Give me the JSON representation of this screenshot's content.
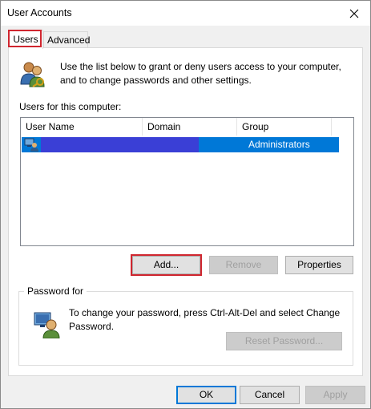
{
  "window": {
    "title": "User Accounts"
  },
  "tabs": [
    {
      "label": "Users"
    },
    {
      "label": "Advanced"
    }
  ],
  "info": {
    "text": "Use the list below to grant or deny users access to your computer, and to change passwords and other settings."
  },
  "users_section": {
    "label": "Users for this computer:",
    "columns": [
      "User Name",
      "Domain",
      "Group"
    ],
    "rows": [
      {
        "group": "Administrators"
      }
    ]
  },
  "buttons": {
    "add": "Add...",
    "remove": "Remove",
    "properties": "Properties",
    "reset_password": "Reset Password...",
    "ok": "OK",
    "cancel": "Cancel",
    "apply": "Apply"
  },
  "password": {
    "legend": "Password for",
    "text": "To change your password, press Ctrl-Alt-Del and select Change Password."
  },
  "colors": {
    "selection": "#0078d7",
    "highlight_border": "#d0262f",
    "redaction": "#3a3fd6"
  }
}
